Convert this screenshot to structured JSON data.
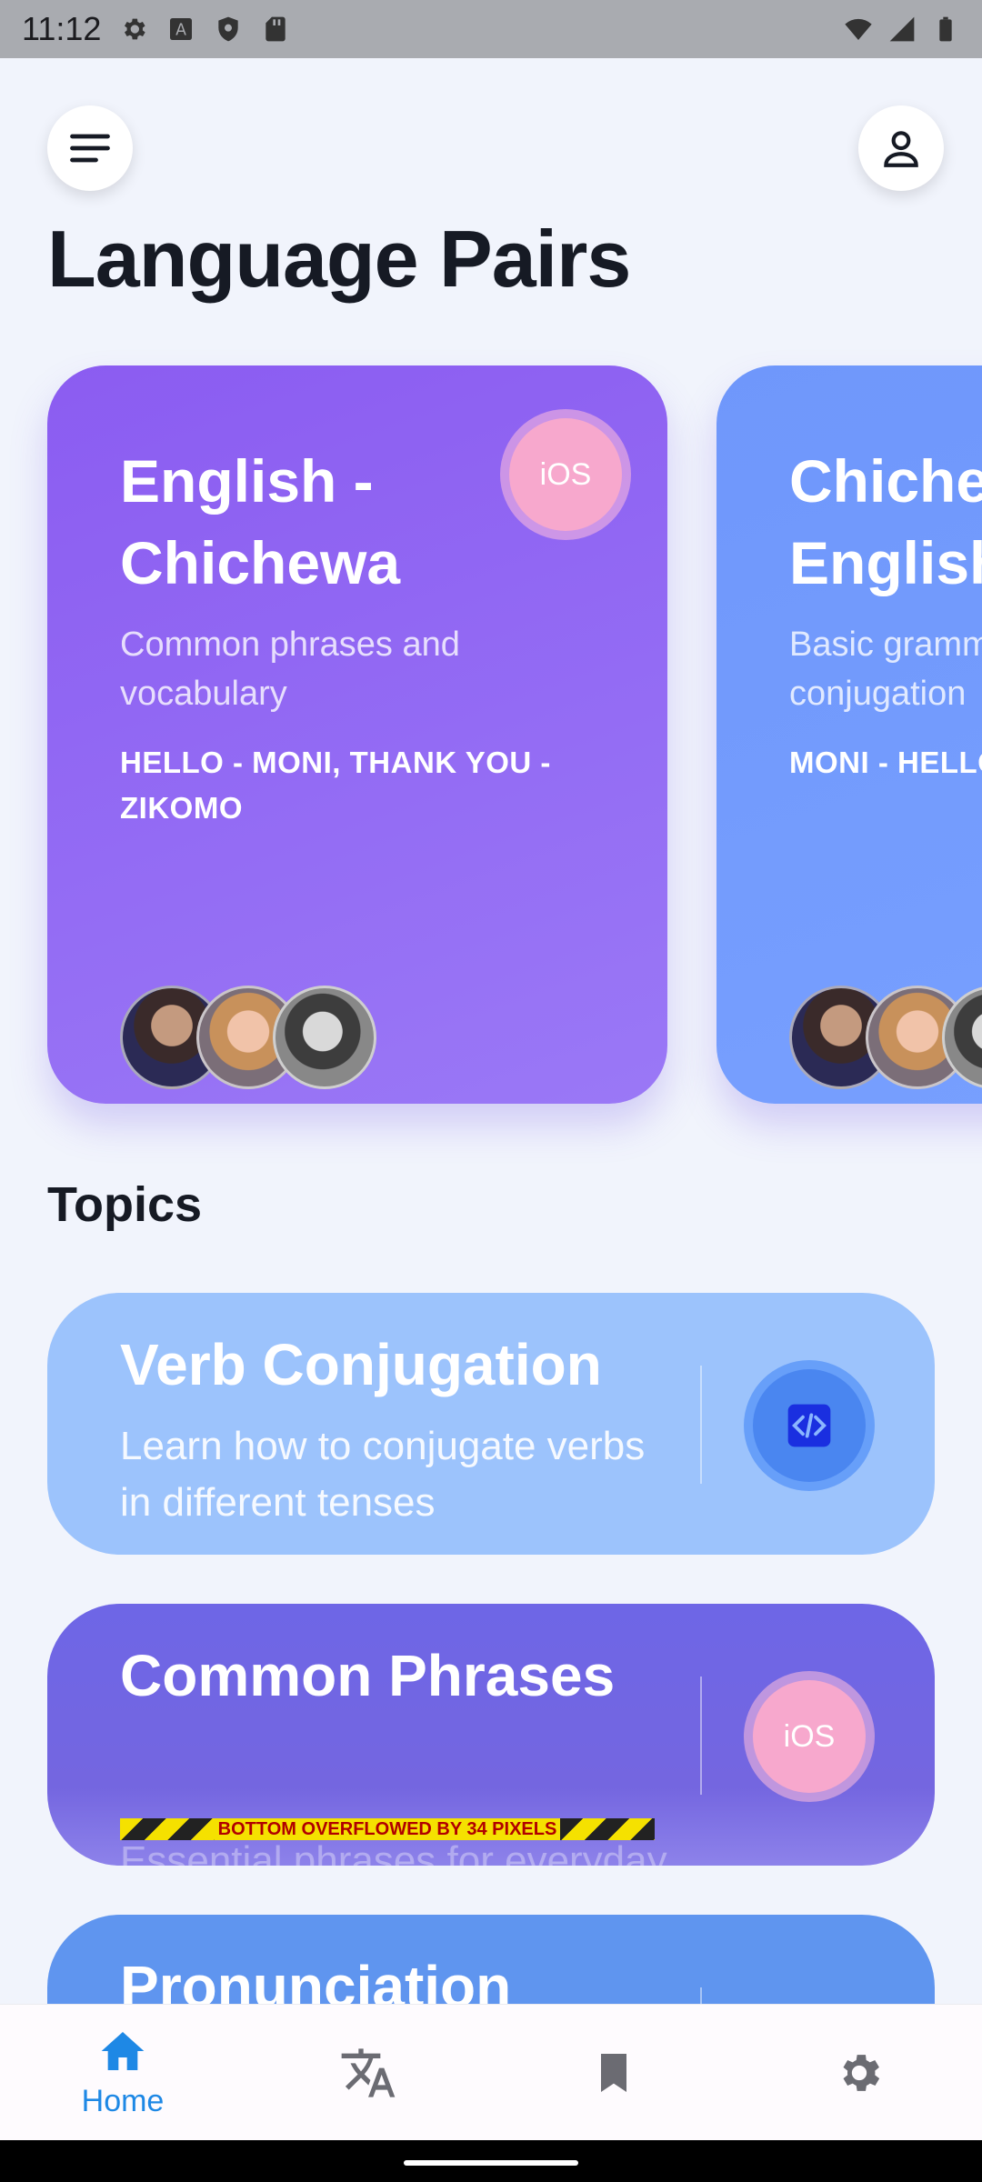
{
  "status_bar": {
    "time": "11:12",
    "left_icons": [
      "gear-icon",
      "keyboard-a-icon",
      "shield-icon",
      "sd-card-icon"
    ],
    "right_icons": [
      "wifi-icon",
      "signal-icon",
      "battery-icon"
    ]
  },
  "header": {
    "menu_icon": "hamburger-menu-icon",
    "profile_icon": "person-icon",
    "title": "Language Pairs"
  },
  "language_pairs": [
    {
      "title": "English - Chichewa",
      "description": "Common phrases and vocabulary",
      "example": "HELLO - MONI, THANK YOU - ZIKOMO",
      "badge": "iOS",
      "color_from": "#8b60f0",
      "color_to": "#9a78f6"
    },
    {
      "title": "Chichewa - English",
      "description": "Basic grammar and conjugation",
      "example": "MONI - HELLO, THANK YOU",
      "color_from": "#6f97fb",
      "color_to": "#78a0ff"
    }
  ],
  "topics": {
    "title": "Topics",
    "items": [
      {
        "title": "Verb Conjugation",
        "description": "Learn how to conjugate verbs in different tenses",
        "badge_icon": "code-icon",
        "color": "#9cc3fc"
      },
      {
        "title": "Common Phrases",
        "description": "Essential phrases for everyday conversations",
        "badge": "iOS",
        "color": "#7466e0",
        "overflow_warning": "BOTTOM OVERFLOWED BY 34 PIXELS"
      },
      {
        "title": "Pronunciation",
        "color": "#5f95ef"
      }
    ]
  },
  "bottom_nav": [
    {
      "label": "Home",
      "icon": "home-icon",
      "active": true
    },
    {
      "icon": "translate-icon"
    },
    {
      "icon": "bookmark-icon"
    },
    {
      "icon": "settings-gear-icon"
    }
  ]
}
